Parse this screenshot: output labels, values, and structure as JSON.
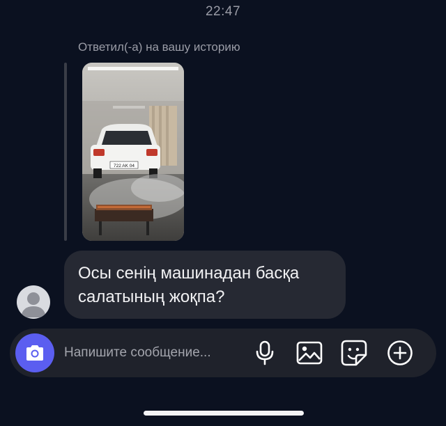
{
  "status": {
    "time": "22:47"
  },
  "story_reply": {
    "label": "Ответил(-а) на вашу историю",
    "plate_text": "722 AK 04"
  },
  "message": {
    "text": "Осы сенің машинадан басқа салатының жоқпа?"
  },
  "composer": {
    "placeholder": "Напишите сообщение..."
  },
  "icons": {
    "camera": "camera-icon",
    "microphone": "microphone-icon",
    "gallery": "image-icon",
    "sticker": "sticker-icon",
    "add": "plus-circle-icon"
  },
  "colors": {
    "background": "#0b1120",
    "bubble": "#262933",
    "composer": "#1f222b",
    "accent": "#5b5ef0"
  }
}
